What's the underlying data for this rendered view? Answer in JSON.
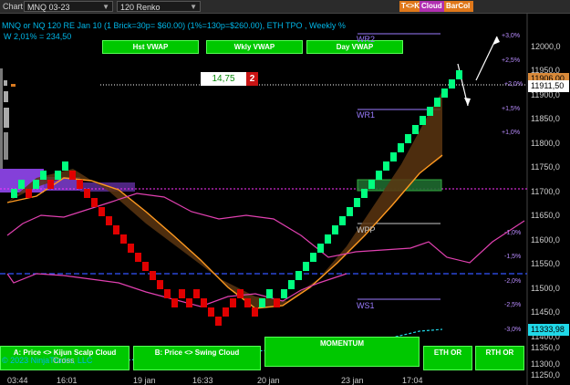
{
  "toolbar": {
    "window_tab": "Chart",
    "instrument": "MNQ 03-23",
    "bar_type": "120 Renko",
    "buttons": [
      "T<>K",
      "Cloud",
      "BarCol"
    ]
  },
  "info": {
    "title_line": "MNQ or NQ 120 RE Jan 10  (1 Brick=30p= $60.00) (1%=130p=$260.00), ETH TPO , Weekly %",
    "w_line": "W 2,01% = 234,50"
  },
  "top_buttons": [
    "Hst VWAP",
    "Wkly VWAP",
    "Day VWAP"
  ],
  "levels": {
    "wr2": "WR2",
    "wr1": "WR1",
    "wpp": "WPP",
    "ws1": "WS1"
  },
  "pct_labels": [
    "+3,0%",
    "+2,5%",
    "+2,0%",
    "+1,5%",
    "+1,0%",
    "-1,0%",
    "-1,5%",
    "-2,0%",
    "-2,5%",
    "-3,0%"
  ],
  "y_labels": [
    "12000,0",
    "11950,0",
    "11900,0",
    "11850,0",
    "11800,0",
    "11750,0",
    "11700,0",
    "11650,0",
    "11600,0",
    "11550,0",
    "11500,0",
    "11450,0",
    "11400,0",
    "11350,0",
    "11300,0",
    "11250,0"
  ],
  "x_labels": [
    "03:44",
    "16:01",
    "19 jan",
    "16:33",
    "20 jan",
    "23 jan",
    "17:04"
  ],
  "price_current": "11911,50",
  "price_under": "11906,00",
  "price_low": "11333,98",
  "box_value": "14,75",
  "box_count": "2",
  "bottom_buttons": [
    "A: Price <> Kijun Scalp Cloud",
    "B: Price <> Swing Cloud",
    "MOMENTUM",
    "ETH OR",
    "RTH OR"
  ],
  "footer": {
    "copyright": "© 2023 NinjaTrader, LLC",
    "cross": "Cross"
  },
  "colors": {
    "brick_up": "#00ff7f",
    "brick_down": "#e00000",
    "cloud": "#5a3510",
    "kijun": "#ff9a20",
    "band": "#e040b0",
    "vwap_line": "#ff33ff",
    "dash_blue": "#3355ff"
  }
}
